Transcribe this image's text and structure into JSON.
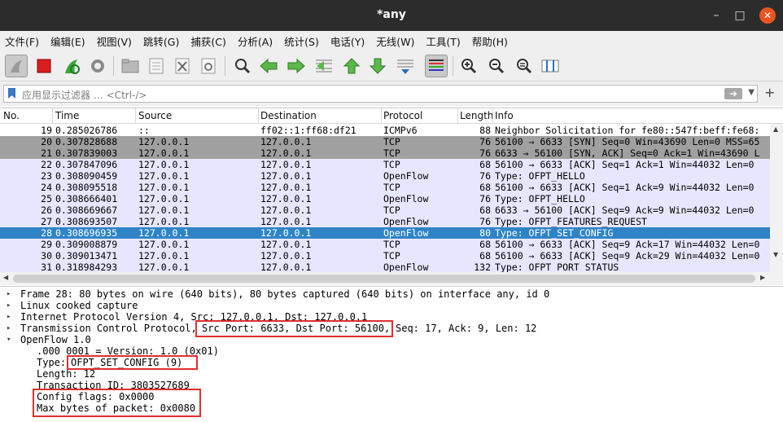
{
  "window": {
    "title": "*any"
  },
  "menu": [
    "文件(F)",
    "编辑(E)",
    "视图(V)",
    "跳转(G)",
    "捕获(C)",
    "分析(A)",
    "统计(S)",
    "电话(Y)",
    "无线(W)",
    "工具(T)",
    "帮助(H)"
  ],
  "filter": {
    "placeholder": "应用显示过滤器 … <Ctrl-/>"
  },
  "columns": {
    "no": "No.",
    "time": "Time",
    "source": "Source",
    "destination": "Destination",
    "protocol": "Protocol",
    "length": "Length",
    "info": "Info"
  },
  "packets": [
    {
      "no": "19",
      "time": "0.285026786",
      "source": "::",
      "destination": "ff02::1:ff68:df21",
      "protocol": "ICMPv6",
      "length": "88",
      "info": "Neighbor Solicitation for fe80::547f:beff:fe68:",
      "style": "white"
    },
    {
      "no": "20",
      "time": "0.307828688",
      "source": "127.0.0.1",
      "destination": "127.0.0.1",
      "protocol": "TCP",
      "length": "76",
      "info": "56100 → 6633 [SYN] Seq=0 Win=43690 Len=0 MSS=65",
      "style": "gray"
    },
    {
      "no": "21",
      "time": "0.307839003",
      "source": "127.0.0.1",
      "destination": "127.0.0.1",
      "protocol": "TCP",
      "length": "76",
      "info": "6633 → 56100 [SYN, ACK] Seq=0 Ack=1 Win=43690 L",
      "style": "gray"
    },
    {
      "no": "22",
      "time": "0.307847096",
      "source": "127.0.0.1",
      "destination": "127.0.0.1",
      "protocol": "TCP",
      "length": "68",
      "info": "56100 → 6633 [ACK] Seq=1 Ack=1 Win=44032 Len=0",
      "style": "lav"
    },
    {
      "no": "23",
      "time": "0.308090459",
      "source": "127.0.0.1",
      "destination": "127.0.0.1",
      "protocol": "OpenFlow",
      "length": "76",
      "info": "Type: OFPT_HELLO",
      "style": "lav"
    },
    {
      "no": "24",
      "time": "0.308095518",
      "source": "127.0.0.1",
      "destination": "127.0.0.1",
      "protocol": "TCP",
      "length": "68",
      "info": "56100 → 6633 [ACK] Seq=1 Ack=9 Win=44032 Len=0",
      "style": "lav"
    },
    {
      "no": "25",
      "time": "0.308666401",
      "source": "127.0.0.1",
      "destination": "127.0.0.1",
      "protocol": "OpenFlow",
      "length": "76",
      "info": "Type: OFPT_HELLO",
      "style": "lav"
    },
    {
      "no": "26",
      "time": "0.308669667",
      "source": "127.0.0.1",
      "destination": "127.0.0.1",
      "protocol": "TCP",
      "length": "68",
      "info": "6633 → 56100 [ACK] Seq=9 Ack=9 Win=44032 Len=0",
      "style": "lav"
    },
    {
      "no": "27",
      "time": "0.308693507",
      "source": "127.0.0.1",
      "destination": "127.0.0.1",
      "protocol": "OpenFlow",
      "length": "76",
      "info": "Type: OFPT_FEATURES_REQUEST",
      "style": "lav"
    },
    {
      "no": "28",
      "time": "0.308696935",
      "source": "127.0.0.1",
      "destination": "127.0.0.1",
      "protocol": "OpenFlow",
      "length": "80",
      "info": "Type: OFPT_SET_CONFIG",
      "style": "selected"
    },
    {
      "no": "29",
      "time": "0.309008879",
      "source": "127.0.0.1",
      "destination": "127.0.0.1",
      "protocol": "TCP",
      "length": "68",
      "info": "56100 → 6633 [ACK] Seq=9 Ack=17 Win=44032 Len=0",
      "style": "lav"
    },
    {
      "no": "30",
      "time": "0.309013471",
      "source": "127.0.0.1",
      "destination": "127.0.0.1",
      "protocol": "TCP",
      "length": "68",
      "info": "56100 → 6633 [ACK] Seq=9 Ack=29 Win=44032 Len=0",
      "style": "lav"
    },
    {
      "no": "31",
      "time": "0.318984293",
      "source": "127.0.0.1",
      "destination": "127.0.0.1",
      "protocol": "OpenFlow",
      "length": "132",
      "info": "Type: OFPT_PORT_STATUS",
      "style": "lav"
    }
  ],
  "details": {
    "frame": "Frame 28: 80 bytes on wire (640 bits), 80 bytes captured (640 bits) on interface any, id 0",
    "linux": "Linux cooked capture",
    "ip": "Internet Protocol Version 4, Src: 127.0.0.1, Dst: 127.0.0.1",
    "tcp_prefix": "Transmission Control Protocol,",
    "tcp_ports": "Src Port: 6633, Dst Port: 56100,",
    "tcp_suffix": "Seq: 17, Ack: 9, Len: 12",
    "openflow": "OpenFlow 1.0",
    "version": ".000 0001 = Version: 1.0 (0x01)",
    "type_label": "Type:",
    "type_value": "OFPT_SET_CONFIG (9)",
    "length": "Length: 12",
    "xid": "Transaction ID: 3803527689",
    "flags": "Config flags: 0x0000",
    "maxbytes": "Max bytes of packet: 0x0080"
  },
  "colors": {
    "selected_bg": "#2f84c7",
    "gray_bg": "#a0a0a0",
    "lav_bg": "#e7e6ff",
    "annotation": "#e03030"
  }
}
